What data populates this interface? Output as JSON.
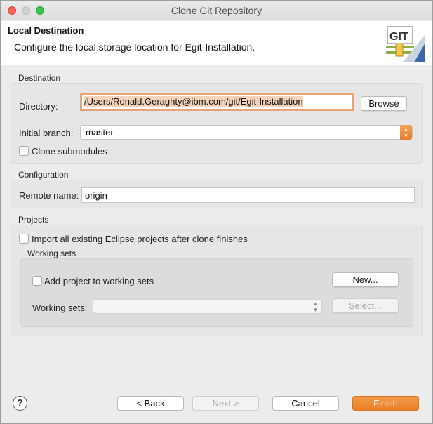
{
  "window": {
    "title": "Clone Git Repository"
  },
  "header": {
    "title": "Local Destination",
    "description": "Configure the local storage location for Egit-Installation.",
    "icon_text": "GIT"
  },
  "destination": {
    "group_label": "Destination",
    "directory_label": "Directory:",
    "directory_value": "/Users/Ronald.Geraghty@ibm.com/git/Egit-Installation",
    "browse_label": "Browse",
    "initial_branch_label": "Initial branch:",
    "initial_branch_value": "master",
    "clone_submodules_label": "Clone submodules",
    "clone_submodules_checked": false
  },
  "configuration": {
    "group_label": "Configuration",
    "remote_name_label": "Remote name:",
    "remote_name_value": "origin"
  },
  "projects": {
    "group_label": "Projects",
    "import_label": "Import all existing Eclipse projects after clone finishes",
    "import_checked": false,
    "working_sets_group_label": "Working sets",
    "add_to_working_sets_label": "Add project to working sets",
    "add_to_working_sets_checked": false,
    "new_button_label": "New...",
    "working_sets_label": "Working sets:",
    "working_sets_value": "",
    "select_button_label": "Select..."
  },
  "footer": {
    "help_label": "?",
    "back_label": "< Back",
    "next_label": "Next >",
    "cancel_label": "Cancel",
    "finish_label": "Finish"
  },
  "colors": {
    "accent": "#ea7f26",
    "focus_ring": "#e9a378",
    "selection": "#f3d3b9"
  }
}
